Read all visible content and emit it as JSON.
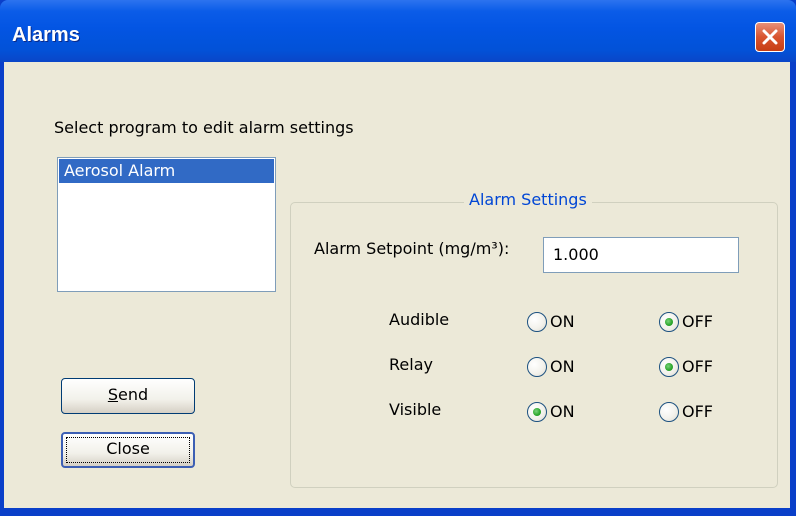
{
  "window": {
    "title": "Alarms"
  },
  "program_list": {
    "prompt": "Select program to edit alarm settings",
    "items": [
      "Aerosol Alarm"
    ],
    "selected": "Aerosol Alarm"
  },
  "buttons": {
    "send_underlined": "S",
    "send_rest": "end",
    "close": "Close"
  },
  "alarm_settings": {
    "group_title": "Alarm Settings",
    "setpoint_label": "Alarm Setpoint (mg/m³):",
    "setpoint_value": "1.000",
    "on_label": "ON",
    "off_label": "OFF",
    "rows": [
      {
        "label": "Audible",
        "selected": "OFF"
      },
      {
        "label": "Relay",
        "selected": "OFF"
      },
      {
        "label": "Visible",
        "selected": "ON"
      }
    ]
  }
}
